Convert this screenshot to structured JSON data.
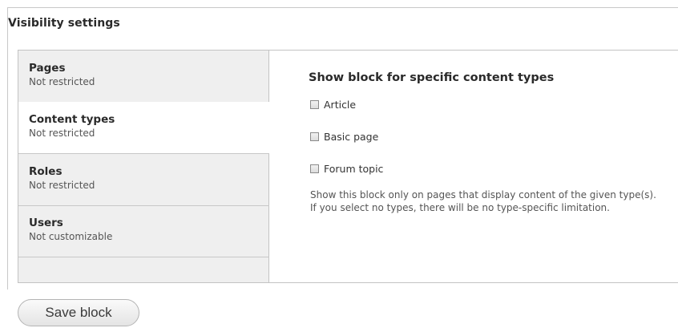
{
  "fieldset": {
    "legend": "Visibility settings"
  },
  "tabs": [
    {
      "title": "Pages",
      "summary": "Not restricted",
      "active": false
    },
    {
      "title": "Content types",
      "summary": "Not restricted",
      "active": true
    },
    {
      "title": "Roles",
      "summary": "Not restricted",
      "active": false
    },
    {
      "title": "Users",
      "summary": "Not customizable",
      "active": false
    }
  ],
  "pane": {
    "title": "Show block for specific content types",
    "options": [
      {
        "label": "Article",
        "checked": false
      },
      {
        "label": "Basic page",
        "checked": false
      },
      {
        "label": "Forum topic",
        "checked": false
      }
    ],
    "description": "Show this block only on pages that display content of the given type(s). If you select no types, there will be no type-specific limitation."
  },
  "actions": {
    "save_label": "Save block"
  },
  "colors": {
    "tab_background": "#efefef",
    "active_tab_background": "#ffffff",
    "border": "#c3c3c3"
  }
}
